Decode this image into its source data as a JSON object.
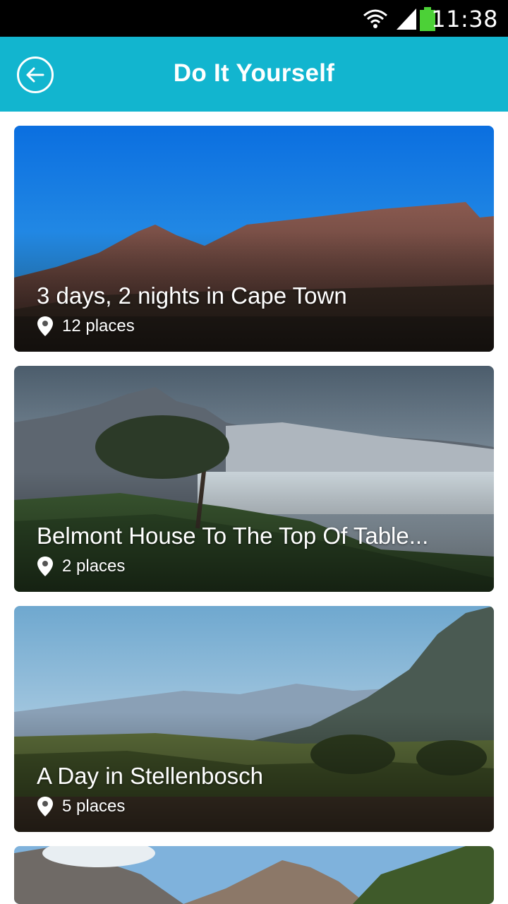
{
  "status_bar": {
    "time": "11:38"
  },
  "app_bar": {
    "title": "Do It Yourself",
    "back_icon": "arrow-left-circle-icon"
  },
  "colors": {
    "app_bar": "#12b5cf",
    "status_bar": "#000000",
    "battery": "#4cd137"
  },
  "trips": [
    {
      "title": "3 days, 2 nights in Cape Town",
      "places": "12 places"
    },
    {
      "title": "Belmont House To The Top Of Table...",
      "places": "2 places"
    },
    {
      "title": "A Day in Stellenbosch",
      "places": "5 places"
    }
  ]
}
